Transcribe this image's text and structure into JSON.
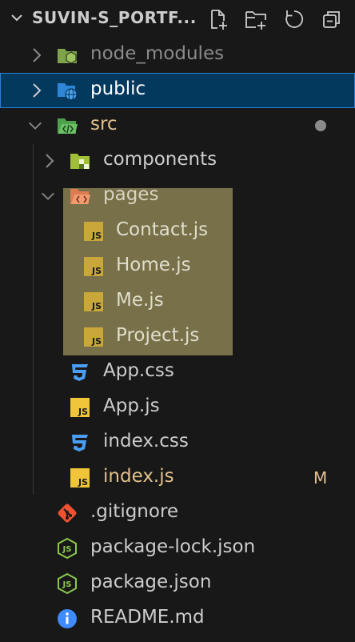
{
  "explorer": {
    "project_title": "SUVIN-S_PORTF...",
    "actions": [
      "new-file",
      "new-folder",
      "refresh",
      "collapse-all"
    ]
  },
  "tree": {
    "node_modules": "node_modules",
    "public": "public",
    "src": "src",
    "components": "components",
    "pages": "pages",
    "contact": "Contact.js",
    "home": "Home.js",
    "me": "Me.js",
    "project": "Project.js",
    "app_css": "App.css",
    "app_js": "App.js",
    "index_css": "index.css",
    "index_js": "index.js",
    "gitignore": ".gitignore",
    "package_lock": "package-lock.json",
    "package_json": "package.json",
    "readme": "README.md"
  },
  "badges": {
    "index_js_status": "M"
  },
  "icons": {
    "js_badge": "JS"
  },
  "colors": {
    "background": "#181818",
    "selected_bg": "#04395e",
    "selected_border": "#2b7fd4",
    "modified": "#e2c08d",
    "js_yellow": "#f1c53a",
    "css_blue": "#4a9ff5",
    "node_green": "#8cc84b",
    "git_orange": "#f05133",
    "info_blue": "#3d8bfd"
  }
}
